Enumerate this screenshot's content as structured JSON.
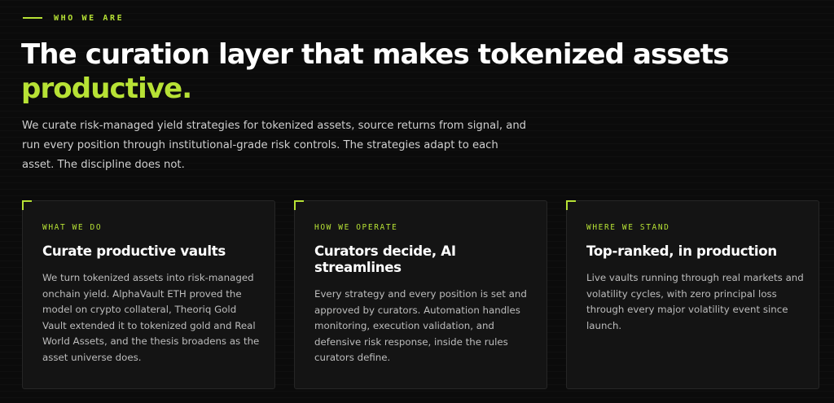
{
  "section": {
    "eyebrow": "WHO WE ARE",
    "headline_main": "The curation layer that makes tokenized assets",
    "headline_accent": "productive.",
    "lead": "We curate risk-managed yield strategies for tokenized assets, source returns from signal, and run every position through institutional-grade risk controls. The strategies adapt to each asset. The discipline does not."
  },
  "cards": [
    {
      "label": "WHAT WE DO",
      "title": "Curate productive vaults",
      "body": "We turn tokenized assets into risk-managed onchain yield. AlphaVault ETH proved the model on crypto collateral, Theoriq Gold Vault extended it to tokenized gold and Real World Assets, and the thesis broadens as the asset universe does."
    },
    {
      "label": "HOW WE OPERATE",
      "title": "Curators decide, AI streamlines",
      "body": "Every strategy and every position is set and approved by curators. Automation handles monitoring, execution validation, and defensive risk response, inside the rules curators define."
    },
    {
      "label": "WHERE WE STAND",
      "title": "Top-ranked, in production",
      "body": "Live vaults running through real markets and volatility cycles, with zero principal loss through every major volatility event since launch."
    }
  ],
  "colors": {
    "accent": "#b7e235",
    "background": "#0b0b0b",
    "card": "#141414"
  }
}
